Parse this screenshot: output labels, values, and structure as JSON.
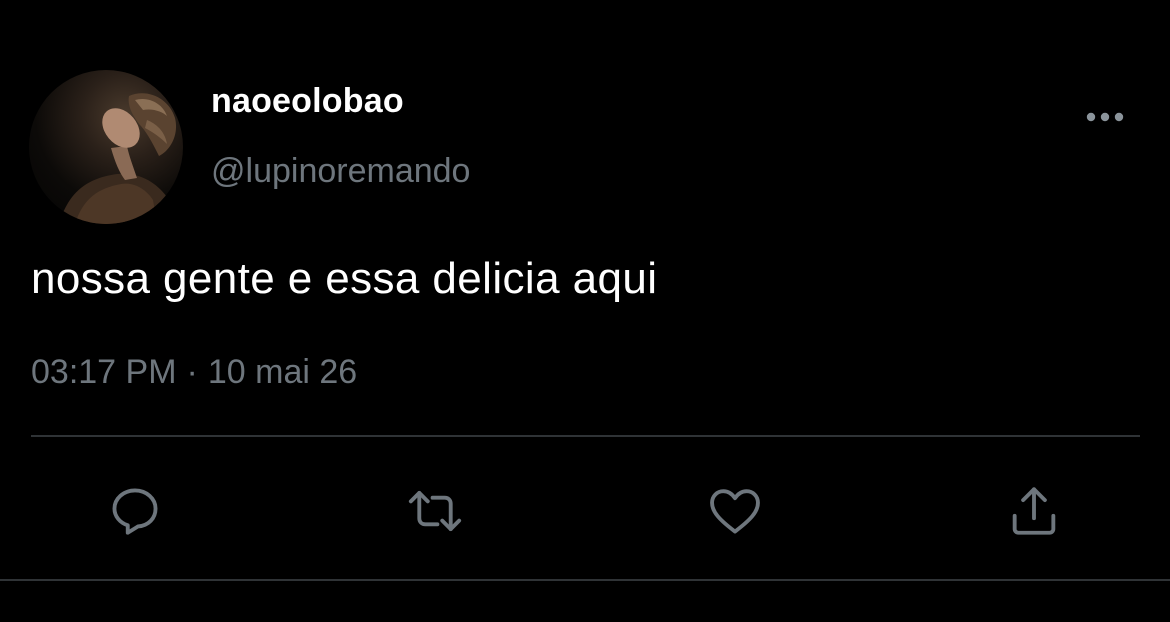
{
  "tweet": {
    "display_name": "naoeolobao",
    "handle": "@lupinoremando",
    "text": "nossa gente e essa delicia aqui",
    "time": "03:17 PM",
    "separator": "·",
    "date": "10 mai 26"
  },
  "icons": {
    "avatar": "profile-photo",
    "more": "more-horizontal-icon",
    "reply": "reply-icon",
    "retweet": "retweet-icon",
    "like": "heart-icon",
    "share": "share-icon"
  },
  "colors": {
    "background": "#000000",
    "primary_text": "#ffffff",
    "secondary_text": "#6e767d",
    "divider": "#2f3336",
    "icon": "#6e767d"
  }
}
